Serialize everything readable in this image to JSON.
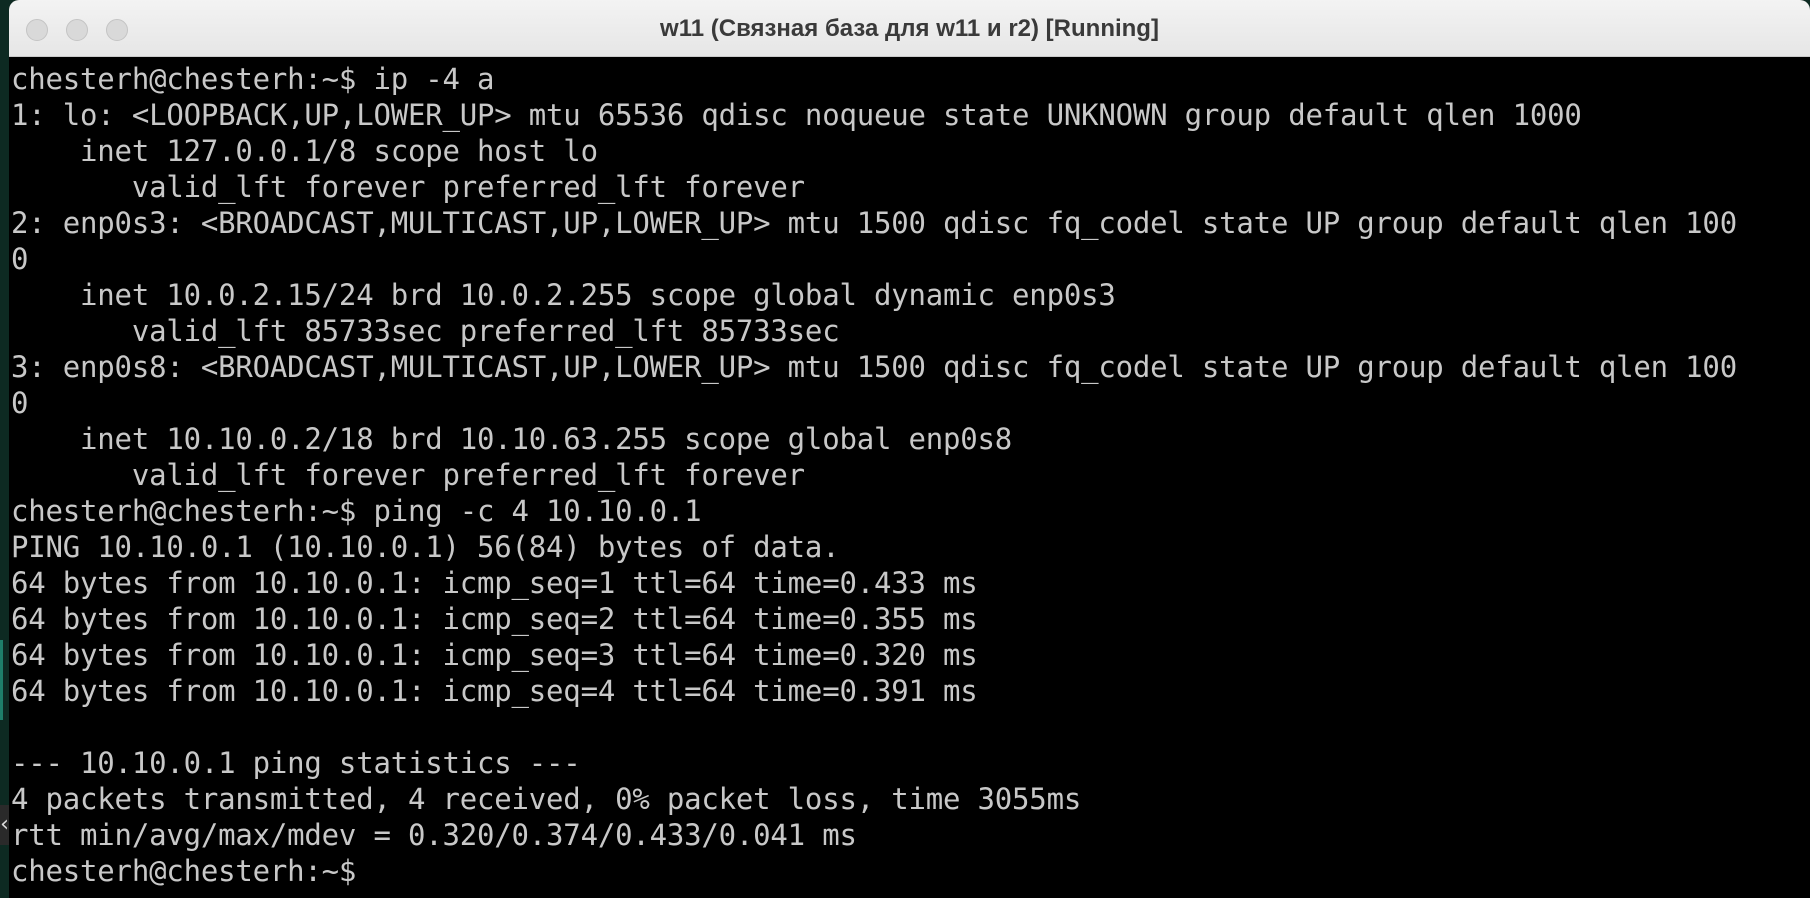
{
  "window": {
    "title": "w11 (Связная база для w11 и r2) [Running]",
    "controls": [
      "close",
      "minimize",
      "zoom"
    ]
  },
  "terminal": {
    "lines": [
      "chesterh@chesterh:~$ ip -4 a",
      "1: lo: <LOOPBACK,UP,LOWER_UP> mtu 65536 qdisc noqueue state UNKNOWN group default qlen 1000",
      "    inet 127.0.0.1/8 scope host lo",
      "       valid_lft forever preferred_lft forever",
      "2: enp0s3: <BROADCAST,MULTICAST,UP,LOWER_UP> mtu 1500 qdisc fq_codel state UP group default qlen 100",
      "0",
      "    inet 10.0.2.15/24 brd 10.0.2.255 scope global dynamic enp0s3",
      "       valid_lft 85733sec preferred_lft 85733sec",
      "3: enp0s8: <BROADCAST,MULTICAST,UP,LOWER_UP> mtu 1500 qdisc fq_codel state UP group default qlen 100",
      "0",
      "    inet 10.10.0.2/18 brd 10.10.63.255 scope global enp0s8",
      "       valid_lft forever preferred_lft forever",
      "chesterh@chesterh:~$ ping -c 4 10.10.0.1",
      "PING 10.10.0.1 (10.10.0.1) 56(84) bytes of data.",
      "64 bytes from 10.10.0.1: icmp_seq=1 ttl=64 time=0.433 ms",
      "64 bytes from 10.10.0.1: icmp_seq=2 ttl=64 time=0.355 ms",
      "64 bytes from 10.10.0.1: icmp_seq=3 ttl=64 time=0.320 ms",
      "64 bytes from 10.10.0.1: icmp_seq=4 ttl=64 time=0.391 ms",
      "",
      "--- 10.10.0.1 ping statistics ---",
      "4 packets transmitted, 4 received, 0% packet loss, time 3055ms",
      "rtt min/avg/max/mdev = 0.320/0.374/0.433/0.041 ms",
      "chesterh@chesterh:~$"
    ]
  },
  "edge_glyph": "‹"
}
